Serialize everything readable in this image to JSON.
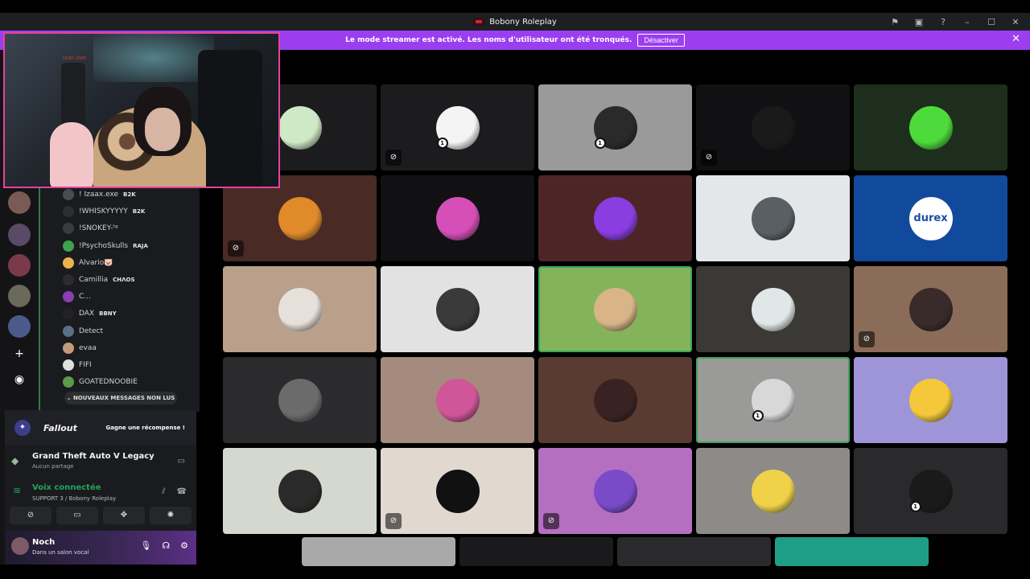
{
  "window": {
    "title": "Bobony Roleplay"
  },
  "banner": {
    "text": "Le mode streamer est activé. Les noms d'utilisateur ont été tronqués.",
    "button": "Désactiver"
  },
  "members": [
    {
      "name": "! Izaax.exe",
      "tag": "B2K",
      "avatar_color": "#4a4c52"
    },
    {
      "name": "!WHISKYYYYY",
      "tag": "B2K",
      "avatar_color": "#2b2d31"
    },
    {
      "name": "!SNOKEY-ᵗᵍ",
      "tag": "",
      "avatar_color": "#3a3b3f"
    },
    {
      "name": "!PsychoSkulls",
      "tag": "RAJA",
      "avatar_color": "#3fa34d"
    },
    {
      "name": "Alvario🐷",
      "tag": "",
      "avatar_color": "#e9b34a"
    },
    {
      "name": "Camillia",
      "tag": "CHΛOS",
      "avatar_color": "#2c2c2c"
    },
    {
      "name": "C...",
      "tag": "",
      "avatar_color": "#8a3fb0"
    },
    {
      "name": "DAX",
      "tag": "BBNY",
      "avatar_color": "#222"
    },
    {
      "name": "Detect",
      "tag": "",
      "avatar_color": "#5a6e8a"
    },
    {
      "name": "evaa",
      "tag": "",
      "avatar_color": "#c49a7c"
    },
    {
      "name": "FIFI",
      "tag": "",
      "avatar_color": "#e0e0e0"
    },
    {
      "name": "GOATEDNOOBIE",
      "tag": "",
      "avatar_color": "#5b9a4a"
    }
  ],
  "new_messages": "NOUVEAUX MESSAGES NON LUS",
  "promo": {
    "game": "Fallout",
    "reward": "Gagne une récompense !"
  },
  "activity": {
    "title": "Grand Theft Auto V Legacy",
    "subtitle": "Aucun partage"
  },
  "voice": {
    "status": "Voix connectée",
    "channel": "SUPPORT 3 / Bobony Roleplay"
  },
  "user": {
    "name": "Noch",
    "status": "Dans un salon vocal"
  },
  "webcam": {
    "label": "DURP USER"
  },
  "tiles": [
    {
      "bg": "#1c1c1f",
      "pic": "#cfe9c6",
      "muted": false,
      "badge": false,
      "speaking": false
    },
    {
      "bg": "#1c1c1f",
      "pic": "#f4f4f4",
      "muted": true,
      "badge": true,
      "speaking": false
    },
    {
      "bg": "#9a9a9a",
      "pic": "#2a2a2a",
      "muted": false,
      "badge": true,
      "speaking": false
    },
    {
      "bg": "#111113",
      "pic": "#1a1a1a",
      "muted": true,
      "badge": false,
      "speaking": false
    },
    {
      "bg": "#1e2e1c",
      "pic": "#4ddb3b",
      "muted": false,
      "badge": false,
      "speaking": false
    },
    {
      "bg": "#4a2a24",
      "pic": "#e08a2a",
      "muted": true,
      "badge": false,
      "speaking": false
    },
    {
      "bg": "#111113",
      "pic": "#d64fb9",
      "muted": false,
      "badge": false,
      "speaking": false
    },
    {
      "bg": "#4e2526",
      "pic": "#8a3de0",
      "muted": false,
      "badge": false,
      "speaking": false
    },
    {
      "bg": "#e4e7ea",
      "pic": "#5a5f64",
      "muted": false,
      "badge": false,
      "speaking": false
    },
    {
      "bg": "#114a9c",
      "pic": "durex",
      "muted": false,
      "badge": false,
      "speaking": false
    },
    {
      "bg": "#b8a08a",
      "pic": "#e6e0da",
      "muted": false,
      "badge": false,
      "speaking": false
    },
    {
      "bg": "#e2e2e2",
      "pic": "#3a3a3a",
      "muted": false,
      "badge": false,
      "speaking": false
    },
    {
      "bg": "#84b35a",
      "pic": "#d8b487",
      "muted": false,
      "badge": false,
      "speaking": true
    },
    {
      "bg": "#3a3936",
      "pic": "#dfe8e6",
      "muted": false,
      "badge": false,
      "speaking": false
    },
    {
      "bg": "#8a6c58",
      "pic": "#3a2b2b",
      "muted": true,
      "badge": false,
      "speaking": false
    },
    {
      "bg": "#2b2b2d",
      "pic": "#6b6b6b",
      "muted": false,
      "badge": false,
      "speaking": false
    },
    {
      "bg": "#a48b7d",
      "pic": "#d0569a",
      "muted": false,
      "badge": false,
      "speaking": false
    },
    {
      "bg": "#5a3b32",
      "pic": "#3b2222",
      "muted": false,
      "badge": false,
      "speaking": false
    },
    {
      "bg": "#9a9a98",
      "pic": "#d8d8d8",
      "muted": false,
      "badge": true,
      "speaking": true
    },
    {
      "bg": "#9d95d8",
      "pic": "#f4c83a",
      "muted": false,
      "badge": false,
      "speaking": false
    },
    {
      "bg": "#d5d8cf",
      "pic": "#2a2a2a",
      "muted": false,
      "badge": false,
      "speaking": false
    },
    {
      "bg": "#e1d8cf",
      "pic": "#111111",
      "muted": true,
      "badge": false,
      "speaking": false
    },
    {
      "bg": "#b56fc1",
      "pic": "#7a4bc8",
      "muted": true,
      "badge": false,
      "speaking": false
    },
    {
      "bg": "#8d8a87",
      "pic": "#f0d24a",
      "muted": false,
      "badge": false,
      "speaking": false
    },
    {
      "bg": "#2a2a2c",
      "pic": "#1a1a1a",
      "muted": false,
      "badge": true,
      "speaking": false
    }
  ],
  "tiles_bottom": [
    "#a9a9a9",
    "#1a1a1c",
    "#2a2a2c",
    "#1e9e86"
  ]
}
